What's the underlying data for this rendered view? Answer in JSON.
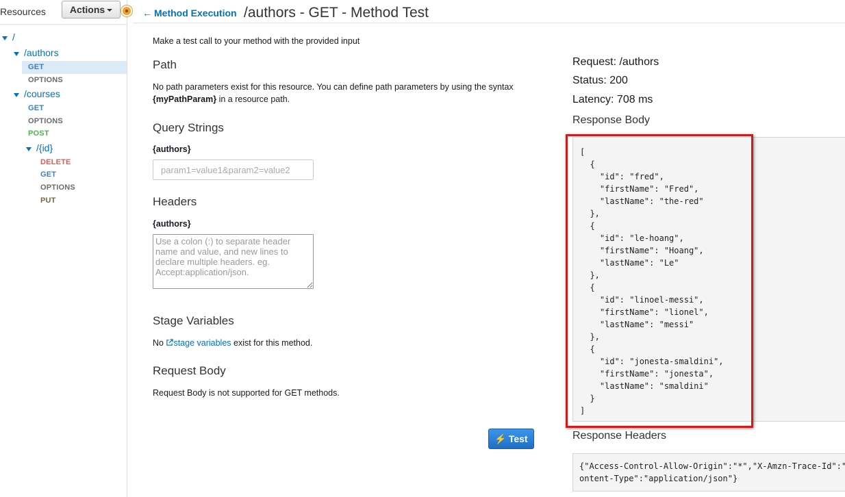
{
  "sidebar": {
    "title": "Resources",
    "actions_label": "Actions",
    "tree": {
      "root": "/",
      "authors": {
        "label": "/authors",
        "methods": [
          "GET",
          "OPTIONS"
        ]
      },
      "courses": {
        "label": "/courses",
        "methods": [
          "GET",
          "OPTIONS",
          "POST"
        ]
      },
      "id": {
        "label": "/{id}",
        "methods": [
          "DELETE",
          "GET",
          "OPTIONS",
          "PUT"
        ]
      }
    }
  },
  "header": {
    "back_label": "Method Execution",
    "title": "/authors - GET - Method Test"
  },
  "left": {
    "intro": "Make a test call to your method with the provided input",
    "path": {
      "heading": "Path",
      "text_line1": "No path parameters exist for this resource. You can define path parameters by using the syntax",
      "text_param": "{myPathParam}",
      "text_line2_rest": " in a resource path."
    },
    "query": {
      "heading": "Query Strings",
      "label": "{authors}",
      "placeholder": "param1=value1&param2=value2"
    },
    "headers": {
      "heading": "Headers",
      "label": "{authors}",
      "placeholder": "Use a colon (:) to separate header name and value, and new lines to declare multiple headers. eg. Accept:application/json."
    },
    "stage": {
      "heading": "Stage Variables",
      "pre": "No ",
      "link": "stage variables",
      "post": " exist for this method."
    },
    "request_body": {
      "heading": "Request Body",
      "text": "Request Body is not supported for GET methods."
    },
    "test_label": "Test"
  },
  "right": {
    "request": "Request: /authors",
    "status": "Status: 200",
    "latency": "Latency: 708 ms",
    "response_body_heading": "Response Body",
    "response_body": "[\n  {\n    \"id\": \"fred\",\n    \"firstName\": \"Fred\",\n    \"lastName\": \"the-red\"\n  },\n  {\n    \"id\": \"le-hoang\",\n    \"firstName\": \"Hoang\",\n    \"lastName\": \"Le\"\n  },\n  {\n    \"id\": \"linoel-messi\",\n    \"firstName\": \"lionel\",\n    \"lastName\": \"messi\"\n  },\n  {\n    \"id\": \"jonesta-smaldini\",\n    \"firstName\": \"jonesta\",\n    \"lastName\": \"smaldini\"\n  }\n]",
    "response_headers_heading": "Response Headers",
    "response_headers": "{\"Access-Control-Allow-Origin\":\"*\",\"X-Amzn-Trace-Id\":\"\nontent-Type\":\"application/json\"}"
  },
  "colors": {
    "link": "#0073bb",
    "get": "#3a7ec6",
    "post": "#49b649",
    "delete": "#e35959",
    "put": "#7e6442",
    "highlight": "#d11a1a",
    "test_button": "#1f6fc4"
  }
}
